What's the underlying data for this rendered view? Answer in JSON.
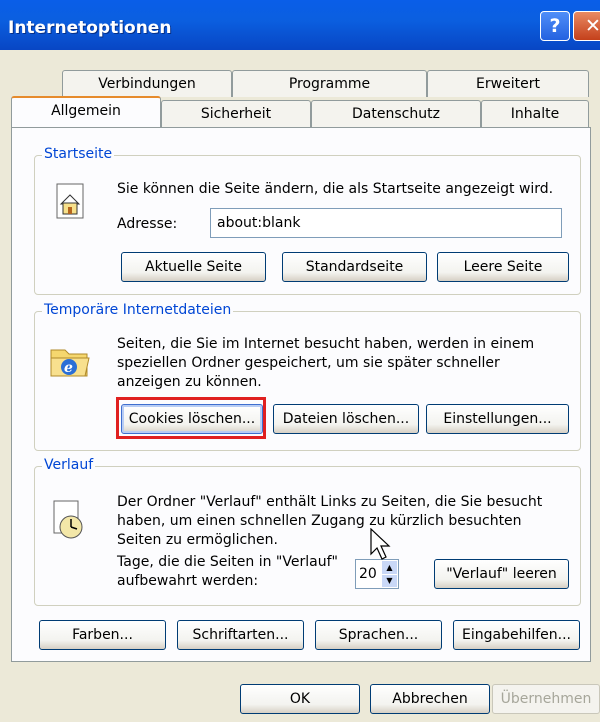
{
  "window": {
    "title": "Internetoptionen"
  },
  "tabs_row1": [
    "Verbindungen",
    "Programme",
    "Erweitert"
  ],
  "tabs_row2": [
    "Allgemein",
    "Sicherheit",
    "Datenschutz",
    "Inhalte"
  ],
  "startseite": {
    "legend": "Startseite",
    "description": "Sie können die Seite ändern, die als Startseite angezeigt wird.",
    "address_label": "Adresse:",
    "address_value": "about:blank",
    "buttons": [
      "Aktuelle Seite",
      "Standardseite",
      "Leere Seite"
    ]
  },
  "temp": {
    "legend": "Temporäre Internetdateien",
    "description_lines": [
      "Seiten, die Sie im Internet besucht haben, werden in einem",
      "speziellen Ordner gespeichert, um sie später schneller",
      "anzeigen zu können."
    ],
    "buttons": [
      "Cookies löschen...",
      "Dateien löschen...",
      "Einstellungen..."
    ]
  },
  "verlauf": {
    "legend": "Verlauf",
    "description_lines": [
      "Der Ordner \"Verlauf\" enthält Links zu Seiten, die Sie besucht",
      "haben, um einen schnellen Zugang zu kürzlich besuchten",
      "Seiten zu ermöglichen."
    ],
    "days_label_lines": [
      "Tage, die die Seiten in \"Verlauf\"",
      "aufbewahrt werden:"
    ],
    "days_value": "20",
    "clear_button": "\"Verlauf\" leeren"
  },
  "bottom_buttons": [
    "Farben...",
    "Schriftarten...",
    "Sprachen...",
    "Eingabehilfen..."
  ],
  "dialog_buttons": {
    "ok": "OK",
    "cancel": "Abbrechen",
    "apply": "Übernehmen"
  },
  "colors": {
    "titlebar": "#0a5ee8",
    "highlight": "#e02020",
    "legend": "#0046d5"
  }
}
